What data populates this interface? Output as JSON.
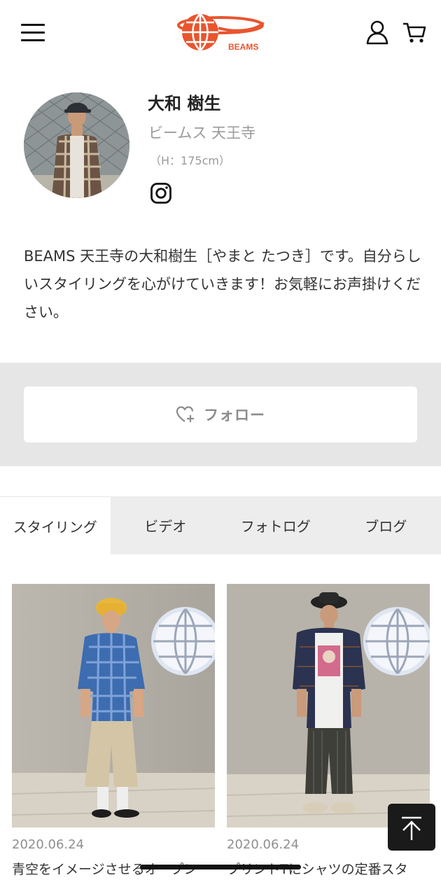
{
  "header": {
    "logo_text": "BEAMS",
    "menu_icon": "hamburger-icon",
    "user_icon": "user-icon",
    "cart_icon": "cart-icon"
  },
  "profile": {
    "name": "大和 樹生",
    "shop": "ビームス 天王寺",
    "height": "（H：175cm）",
    "social_icon": "instagram-icon",
    "bio": "BEAMS 天王寺の大和樹生［やまと たつき］です。自分らしいスタイリングを心がけていきます！お気軽にお声掛けください。"
  },
  "follow": {
    "label": "フォロー",
    "icon": "heart-plus-icon"
  },
  "tabs": [
    {
      "label": "スタイリング",
      "active": true
    },
    {
      "label": "ビデオ",
      "active": false
    },
    {
      "label": "フォトログ",
      "active": false
    },
    {
      "label": "ブログ",
      "active": false
    }
  ],
  "stylings": [
    {
      "date": "2020.06.24",
      "title": "青空をイメージさせるオープン"
    },
    {
      "date": "2020.06.24",
      "title": "プリントTにシャツの定番スタ"
    }
  ],
  "scroll_top_icon": "arrow-up-to-top-icon",
  "colors": {
    "brand_red": "#e8552f",
    "band_gray": "#e6e6e6",
    "muted_text": "#9a9a9a"
  }
}
